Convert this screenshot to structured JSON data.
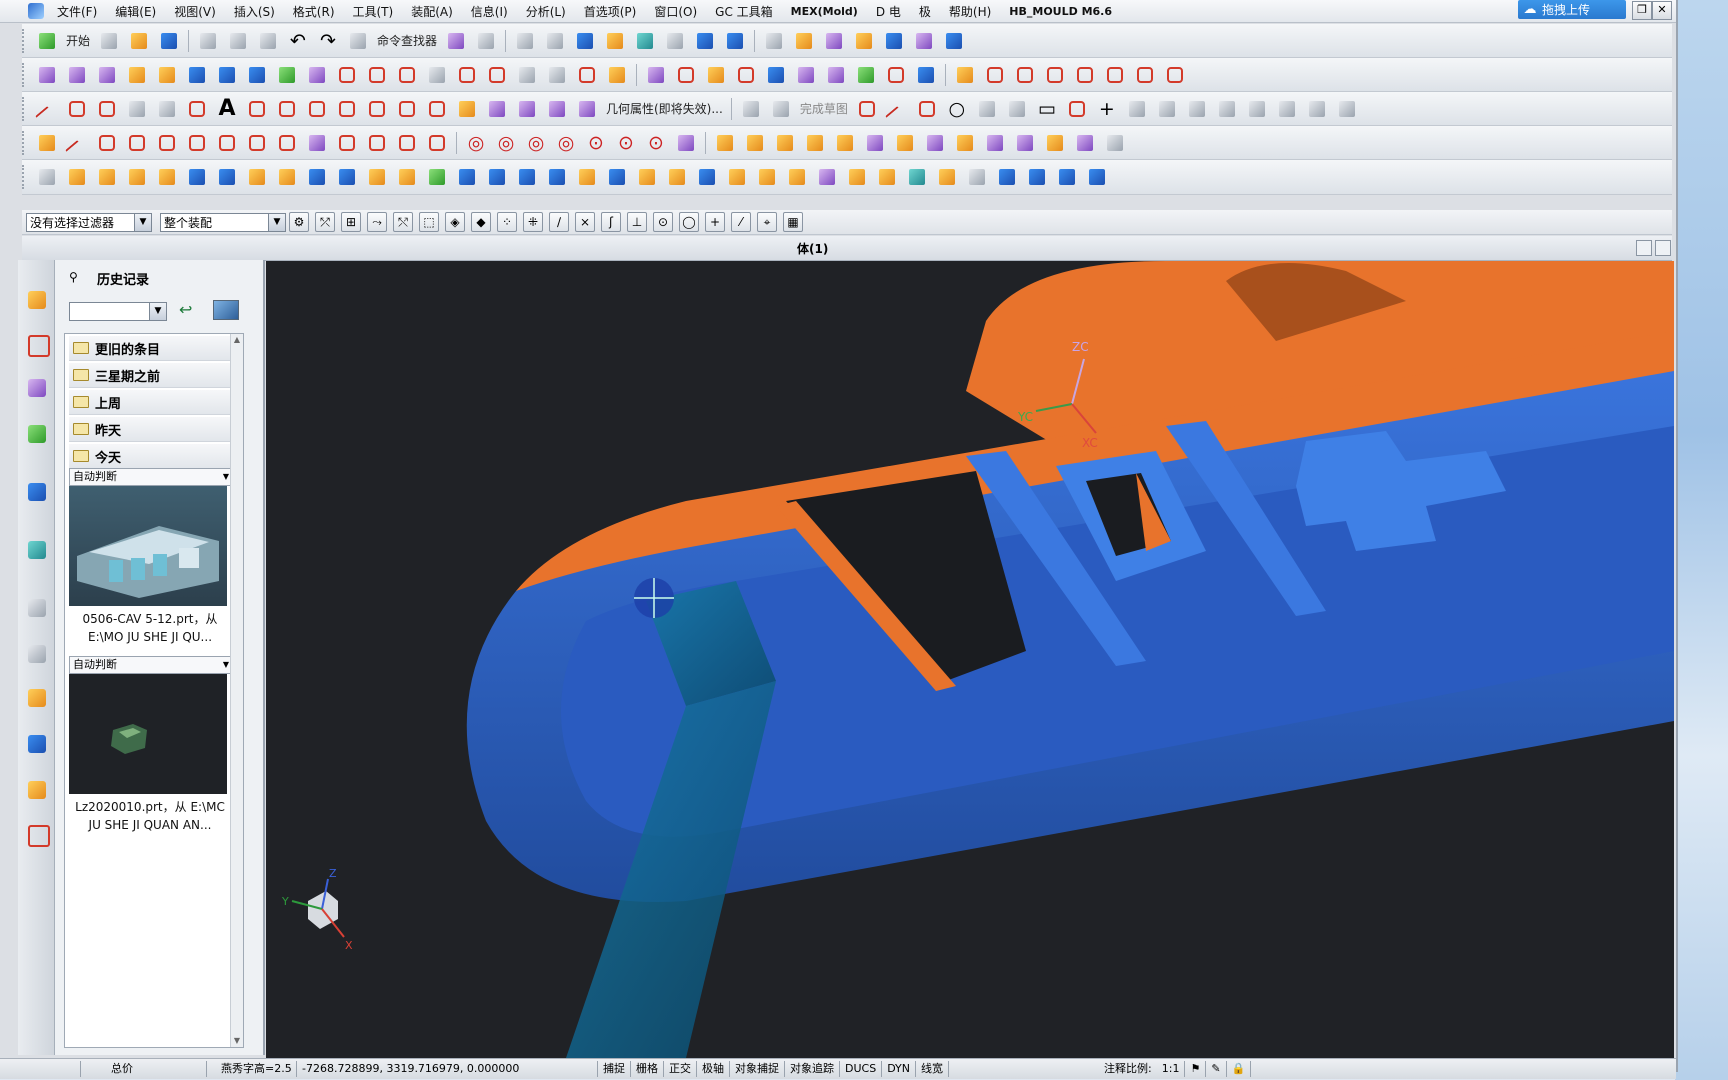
{
  "menubar": {
    "items": [
      "文件(F)",
      "编辑(E)",
      "视图(V)",
      "插入(S)",
      "格式(R)",
      "工具(T)",
      "装配(A)",
      "信息(I)",
      "分析(L)",
      "首选项(P)",
      "窗口(O)",
      "GC 工具箱",
      "MEX(Mold)",
      "D 电",
      "极",
      "帮助(H)",
      "HB_MOULD M6.6"
    ],
    "cloud_upload": "拖拽上传"
  },
  "toolbar": {
    "start_label": "开始",
    "command_finder_label": "命令查找器",
    "geometry_property_label": "几何属性(即将失效)...",
    "finish_sketch_label": "完成草图"
  },
  "filterbar": {
    "selection_filter": "没有选择过滤器",
    "assembly_scope": "整个装配"
  },
  "viewport": {
    "title": "体(1)",
    "axis_labels": {
      "zc": "ZC",
      "yc": "YC",
      "xc": "XC",
      "z": "Z",
      "y": "Y",
      "x": "X"
    },
    "colors": {
      "background": "#202226",
      "core_blue": "#2f63c9",
      "cavity_orange": "#e8732c",
      "slider_teal": "#0f5e86"
    }
  },
  "resource_bar": {
    "title": "历史记录",
    "groups": [
      "更旧的条目",
      "三星期之前",
      "上周",
      "昨天",
      "今天"
    ],
    "records": [
      {
        "label": "自动判断",
        "caption_line1": "0506-CAV 5-12.prt，从",
        "caption_line2": "E:\\MO JU SHE JI QU..."
      },
      {
        "label": "自动判断",
        "caption_line1": "Lz2020010.prt，从 E:\\MC",
        "caption_line2": "JU SHE JI QUAN AN..."
      }
    ]
  },
  "statusbar": {
    "left_cells": [
      "",
      "总价"
    ],
    "message": "燕秀字高=2.5",
    "coords": "-7268.728899, 3319.716979, 0.000000",
    "snap_items": [
      "捕捉",
      "栅格",
      "正交",
      "极轴",
      "对象捕捉",
      "对象追踪",
      "DUCS",
      "DYN",
      "线宽"
    ],
    "annotation_scale_label": "注释比例:",
    "annotation_scale_value": "1:1"
  }
}
